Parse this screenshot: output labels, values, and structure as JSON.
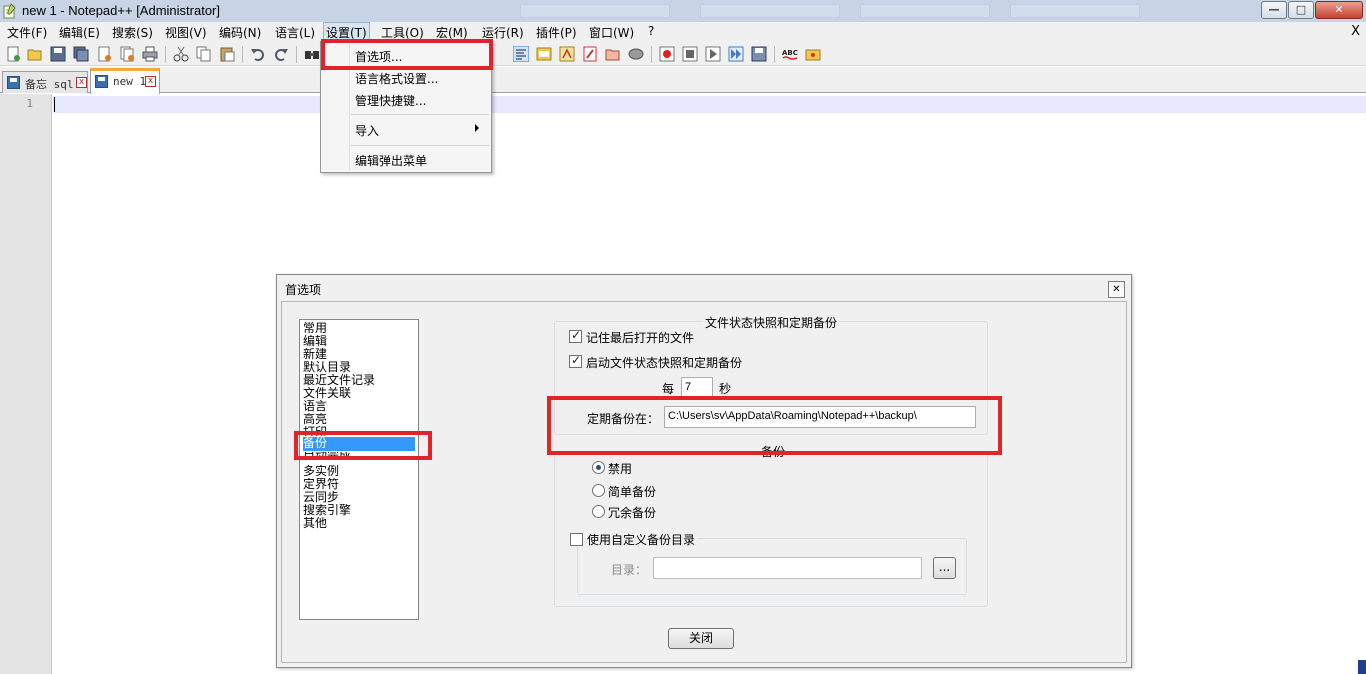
{
  "window": {
    "title": "new 1 - Notepad++ [Administrator]",
    "buttons": {
      "minimize": "—",
      "maximize": "□",
      "close": "✕"
    }
  },
  "menubar": {
    "items": [
      "文件(F)",
      "编辑(E)",
      "搜索(S)",
      "视图(V)",
      "编码(N)",
      "语言(L)",
      "设置(T)",
      "工具(O)",
      "宏(M)",
      "运行(R)",
      "插件(P)",
      "窗口(W)",
      "?"
    ],
    "active": "设置(T)",
    "doc_close": "X"
  },
  "tabs": [
    {
      "label": "备忘 sql",
      "close": "x",
      "active": false
    },
    {
      "label": "new 1",
      "close": "x",
      "active": true
    }
  ],
  "editor": {
    "line_numbers": [
      "1"
    ]
  },
  "settings_menu": {
    "items": [
      "首选项...",
      "语言格式设置...",
      "管理快捷键...",
      "导入",
      "编辑弹出菜单"
    ],
    "highlighted": "首选项..."
  },
  "dialog": {
    "title": "首选项",
    "close": "✕",
    "categories": [
      "常用",
      "编辑",
      "新建",
      "默认目录",
      "最近文件记录",
      "文件关联",
      "语言",
      "高亮",
      "打印",
      "备份",
      "自动完成",
      "多实例",
      "定界符",
      "云同步",
      "搜索引擎",
      "其他"
    ],
    "selected_category": "备份",
    "snapshot_group": {
      "title": "文件状态快照和定期备份",
      "remember_last": {
        "label": "记住最后打开的文件",
        "checked": true
      },
      "enable_snapshot": {
        "label": "启动文件状态快照和定期备份",
        "checked": true
      },
      "interval_prefix": "每",
      "interval_value": "7",
      "interval_unit": "秒",
      "backup_path_label": "定期备份在：",
      "backup_path_value": "C:\\Users\\sv\\AppData\\Roaming\\Notepad++\\backup\\"
    },
    "backup_group": {
      "title": "备份",
      "options": [
        "禁用",
        "简单备份",
        "冗余备份"
      ],
      "selected": "禁用",
      "custom_dir": {
        "label": "使用自定义备份目录",
        "checked": false
      },
      "dir_label": "目录：",
      "dir_value": "",
      "browse_label": "..."
    },
    "close_button": "关闭"
  },
  "colors": {
    "highlight_red": "#e0242b",
    "selection_blue": "#3399ff",
    "active_tab_accent": "#f3a93b",
    "current_line": "#e8e8ff"
  }
}
